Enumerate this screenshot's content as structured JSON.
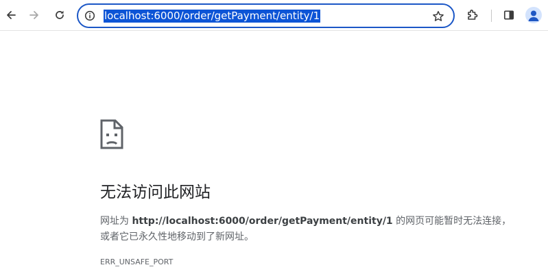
{
  "browser": {
    "omnibox": {
      "url": "localhost:6000/order/getPayment/entity/1",
      "info_icon": "info-icon",
      "bookmark_icon": "star-icon"
    },
    "icons": {
      "back": "arrow-left-icon",
      "forward": "arrow-right-icon",
      "reload": "reload-icon",
      "extensions": "puzzle-icon",
      "side_panel": "side-panel-icon",
      "profile": "profile-avatar-icon"
    },
    "accent_color": "#1a56c6",
    "selection_color": "#0c54d6"
  },
  "error_page": {
    "icon": "sad-page-icon",
    "title": "无法访问此网站",
    "desc_prefix": "网址为 ",
    "desc_url": "http://localhost:6000/order/getPayment/entity/1",
    "desc_suffix": " 的网页可能暂时无法连接，或者它已永久性地移动到了新网址。",
    "error_code": "ERR_UNSAFE_PORT"
  }
}
